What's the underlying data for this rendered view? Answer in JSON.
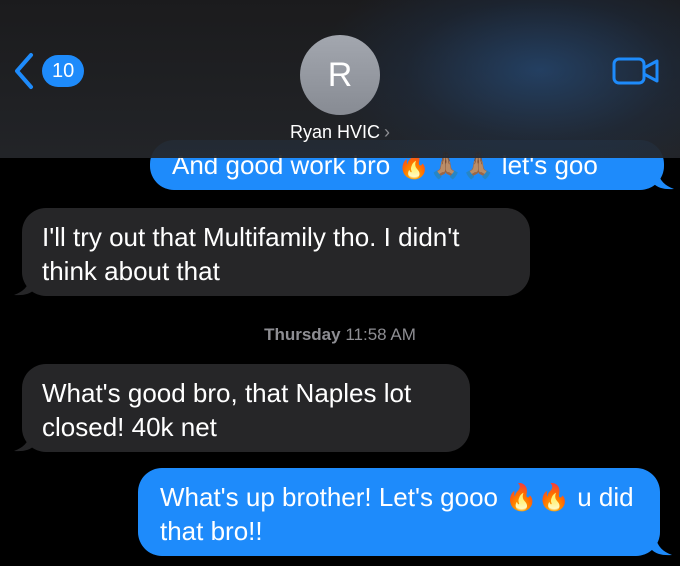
{
  "header": {
    "back_count": "10",
    "avatar_initial": "R",
    "contact_name": "Ryan HVIC",
    "chevron": "›",
    "icons": {
      "back": "chevron-left-icon",
      "video": "video-camera-icon"
    },
    "accent_color": "#1e8bfb"
  },
  "messages": [
    {
      "direction": "outgoing",
      "text": "And good work bro 🔥🙏🏽🙏🏽 let's goo"
    },
    {
      "direction": "incoming",
      "text": "I'll try out that Multifamily tho. I didn't think about that"
    },
    {
      "direction": "incoming",
      "text": "What's good bro, that Naples lot closed! 40k net"
    },
    {
      "direction": "outgoing",
      "text": "What's up brother! Let's gooo 🔥🔥 u did that bro!!"
    }
  ],
  "timestamp": {
    "day": "Thursday",
    "time": "11:58 AM"
  },
  "colors": {
    "incoming_bubble": "#262628",
    "outgoing_bubble": "#1e8bfb",
    "background": "#000000"
  }
}
